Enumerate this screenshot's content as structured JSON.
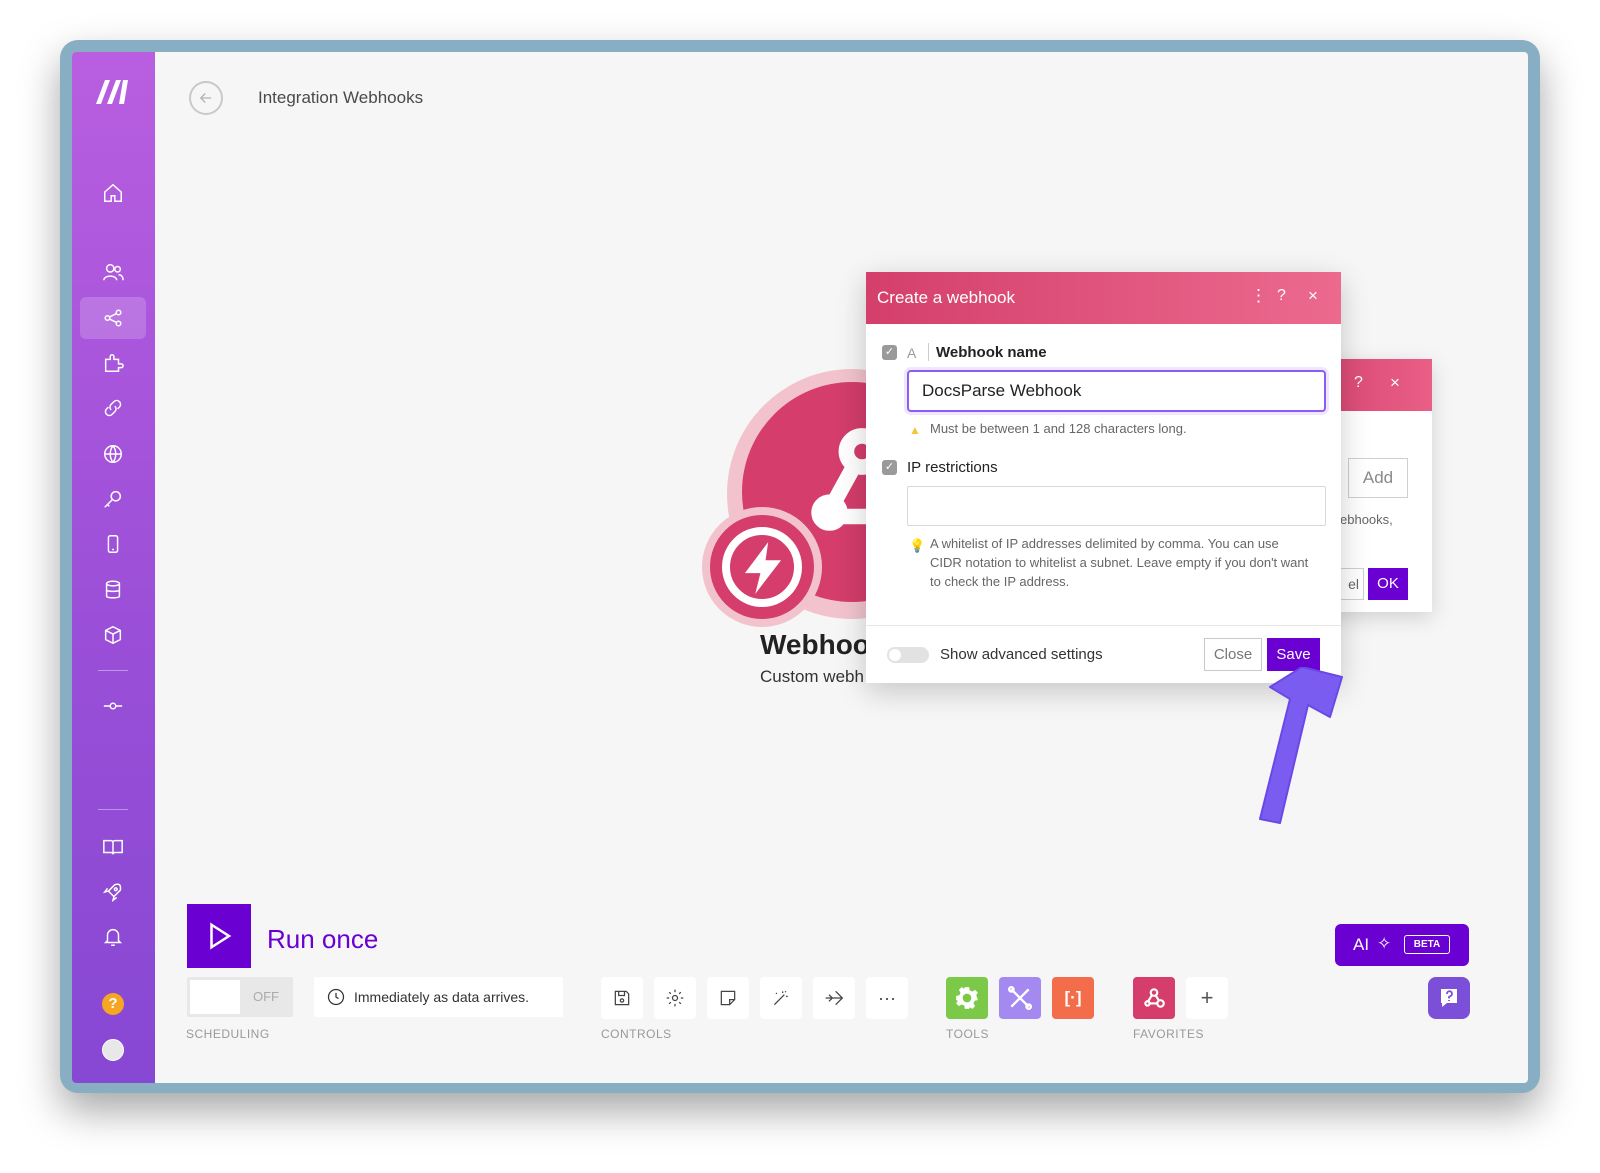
{
  "header": {
    "title": "Integration Webhooks"
  },
  "module": {
    "name": "Webhoo",
    "subtitle": "Custom webh"
  },
  "back_dialog": {
    "add_label": "Add",
    "text": "ebhooks,",
    "cancel_label": "el",
    "ok_label": "OK",
    "help": "?",
    "close": "×"
  },
  "dialog": {
    "title": "Create a webhook",
    "menu_glyph": "⋮",
    "help_glyph": "?",
    "close_glyph": "×",
    "webhook_name_label": "Webhook name",
    "type_glyph": "A",
    "webhook_name_value": "DocsParse Webhook",
    "name_hint": "Must be between 1 and 128 characters long.",
    "ip_label": "IP restrictions",
    "ip_value": "",
    "ip_hint_line1": "A whitelist of IP addresses delimited by comma. You can use",
    "ip_hint_line2": "CIDR notation to whitelist a subnet. Leave empty if you don't want",
    "ip_hint_line3": "to check the IP address.",
    "advanced_label": "Show advanced settings",
    "close_label": "Close",
    "save_label": "Save"
  },
  "toolbar": {
    "run_label": "Run once",
    "schedule_state": "OFF",
    "schedule_text": "Immediately as data arrives.",
    "sections": {
      "scheduling": "SCHEDULING",
      "controls": "CONTROLS",
      "tools": "TOOLS",
      "favorites": "FAVORITES"
    },
    "more_glyph": "···",
    "add_glyph": "+",
    "ai_label": "AI",
    "ai_beta": "BETA"
  },
  "sidebar": {
    "help_glyph": "?",
    "items": [
      "home-icon",
      "team-icon",
      "scenarios-icon",
      "apps-icon",
      "connections-icon",
      "webhooks-icon",
      "keys-icon",
      "devices-icon",
      "data-stores-icon",
      "data-structures-icon",
      "custom-functions-icon",
      "docs-icon",
      "resources-icon",
      "notifications-icon",
      "help-icon",
      "profile-icon"
    ]
  },
  "colors": {
    "accent": "#6a00d1",
    "webhook": "#d43d6c",
    "sidebar_top": "#b95ee0",
    "sidebar_bottom": "#8748d3",
    "arrow": "#7b5cf0"
  }
}
